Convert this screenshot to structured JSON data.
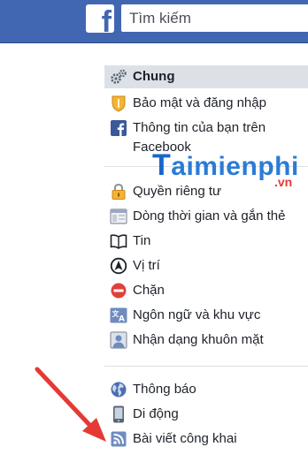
{
  "header": {
    "logo_letter": "f",
    "search_placeholder": "Tìm kiếm"
  },
  "settings_menu": {
    "group1": [
      {
        "label": "Chung",
        "icon": "gear-icon",
        "active": true
      },
      {
        "label": "Bảo mật và đăng nhập",
        "icon": "shield-icon"
      },
      {
        "label": "Thông tin của bạn trên",
        "label_line2": "Facebook",
        "icon": "facebook-icon"
      }
    ],
    "group2": [
      {
        "label": "Quyền riêng tư",
        "icon": "lock-icon"
      },
      {
        "label": "Dòng thời gian và gắn thẻ",
        "icon": "timeline-icon"
      },
      {
        "label": "Tin",
        "icon": "book-icon"
      },
      {
        "label": "Vị trí",
        "icon": "location-icon"
      },
      {
        "label": "Chặn",
        "icon": "block-icon"
      },
      {
        "label": "Ngôn ngữ và khu vực",
        "icon": "language-icon"
      },
      {
        "label": "Nhận dạng khuôn mặt",
        "icon": "face-recognition-icon"
      }
    ],
    "group3": [
      {
        "label": "Thông báo",
        "icon": "globe-icon"
      },
      {
        "label": "Di động",
        "icon": "mobile-icon"
      },
      {
        "label": "Bài viết công khai",
        "icon": "rss-icon"
      }
    ]
  },
  "watermark": {
    "brand_first": "T",
    "brand_rest": "aimienphi",
    "suffix": ".vn"
  },
  "colors": {
    "header_blue": "#4267b2",
    "active_bg": "#dce1e8",
    "arrow_red": "#e53935"
  }
}
